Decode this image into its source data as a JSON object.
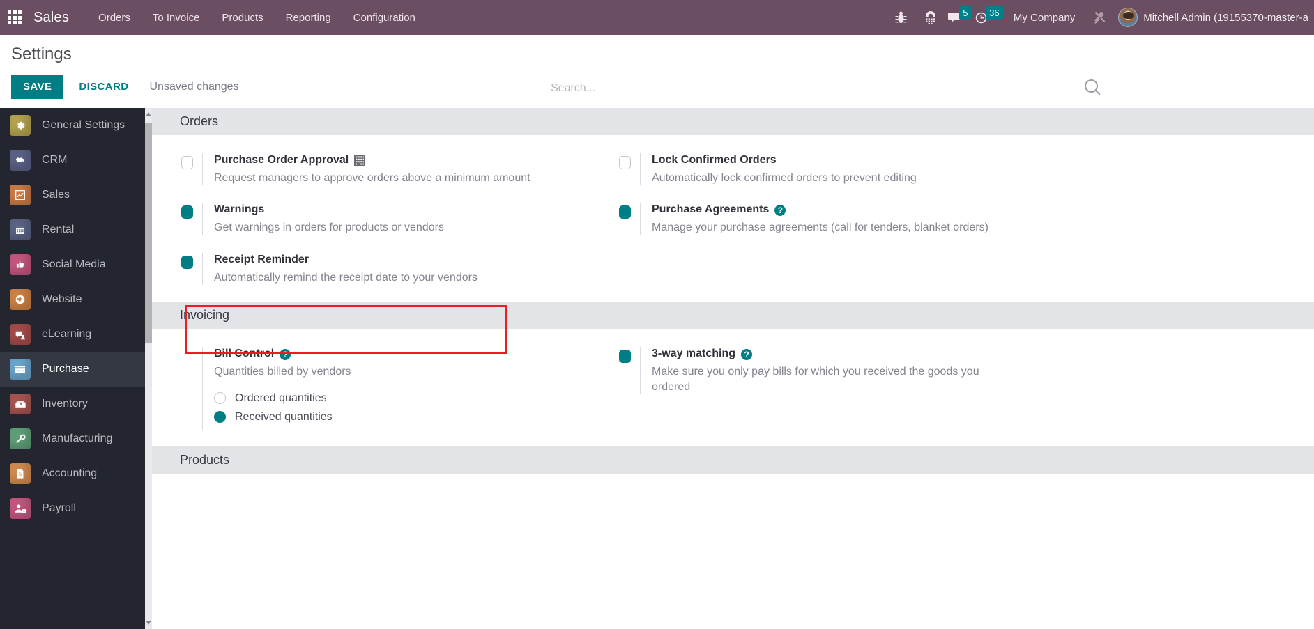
{
  "navbar": {
    "apps_icon": "grid-apps-icon",
    "brand": "Sales",
    "menu": [
      {
        "label": "Orders"
      },
      {
        "label": "To Invoice"
      },
      {
        "label": "Products"
      },
      {
        "label": "Reporting"
      },
      {
        "label": "Configuration"
      }
    ],
    "icons": [
      {
        "name": "bug-icon",
        "glyph": "☣"
      },
      {
        "name": "dialpad-icon",
        "glyph": "☷"
      }
    ],
    "messages": {
      "icon": "chat-bubble-icon",
      "count": "5"
    },
    "activities": {
      "icon": "clock-icon",
      "count": "36"
    },
    "company": "My Company",
    "tools_icon": "tools-icon",
    "user": "Mitchell Admin (19155370-master-a",
    "accent": "#00808a",
    "bar_color": "#6b4e61"
  },
  "control_panel": {
    "title": "Settings",
    "save_label": "SAVE",
    "discard_label": "DISCARD",
    "status": "Unsaved changes",
    "search_placeholder": "Search...",
    "search_value": "",
    "search_icon": "search-icon"
  },
  "sidebar": {
    "items": [
      {
        "label": "General Settings",
        "icon": "gear-icon",
        "glyph": "⚙",
        "color": "#b4a24e",
        "active": false
      },
      {
        "label": "CRM",
        "icon": "handshake-icon",
        "glyph": "✋",
        "color": "#5b6186",
        "active": false
      },
      {
        "label": "Sales",
        "icon": "chart-line-icon",
        "glyph": "↗",
        "color": "#c97a45",
        "active": false
      },
      {
        "label": "Rental",
        "icon": "calendar-icon",
        "glyph": "▦",
        "color": "#5a6285",
        "active": false
      },
      {
        "label": "Social Media",
        "icon": "thumbs-up-icon",
        "glyph": "☝",
        "color": "#c2567e",
        "active": false
      },
      {
        "label": "Website",
        "icon": "globe-icon",
        "glyph": "ἱ0",
        "color": "#cd8145",
        "active": false
      },
      {
        "label": "eLearning",
        "icon": "elearning-icon",
        "glyph": "✎",
        "color": "#a24b49",
        "active": false
      },
      {
        "label": "Purchase",
        "icon": "credit-card-icon",
        "glyph": "▤",
        "color": "#6aa4cc",
        "active": true
      },
      {
        "label": "Inventory",
        "icon": "box-icon",
        "glyph": "▣",
        "color": "#a65450",
        "active": false
      },
      {
        "label": "Manufacturing",
        "icon": "wrench-icon",
        "glyph": "⚒",
        "color": "#5f9e77",
        "active": false
      },
      {
        "label": "Accounting",
        "icon": "dollar-doc-icon",
        "glyph": "$",
        "color": "#d08a4e",
        "active": false
      },
      {
        "label": "Payroll",
        "icon": "payroll-icon",
        "glyph": "☺",
        "color": "#c4567f",
        "active": false
      }
    ]
  },
  "sections": [
    {
      "title": "Orders",
      "left": [
        {
          "name": "purchase-order-approval",
          "title": "Purchase Order Approval",
          "desc": "Request managers to approve orders above a minimum amount",
          "enabled": false,
          "extra_icon": "building-icon"
        },
        {
          "name": "warnings",
          "title": "Warnings",
          "desc": "Get warnings in orders for products or vendors",
          "enabled": true,
          "highlighted": true
        },
        {
          "name": "receipt-reminder",
          "title": "Receipt Reminder",
          "desc": "Automatically remind the receipt date to your vendors",
          "enabled": true
        }
      ],
      "right": [
        {
          "name": "lock-confirmed-orders",
          "title": "Lock Confirmed Orders",
          "desc": "Automatically lock confirmed orders to prevent editing",
          "enabled": false
        },
        {
          "name": "purchase-agreements",
          "title": "Purchase Agreements",
          "desc": "Manage your purchase agreements (call for tenders, blanket orders)",
          "enabled": true,
          "help": "?"
        }
      ]
    },
    {
      "title": "Invoicing",
      "left": [
        {
          "name": "bill-control",
          "title": "Bill Control",
          "desc": "Quantities billed by vendors",
          "enabled": null,
          "help": "?",
          "radios": [
            {
              "label": "Ordered quantities",
              "selected": false
            },
            {
              "label": "Received quantities",
              "selected": true
            }
          ]
        }
      ],
      "right": [
        {
          "name": "three-way-matching",
          "title": "3-way matching",
          "desc": "Make sure you only pay bills for which you received the goods you ordered",
          "enabled": true,
          "help": "?"
        }
      ]
    },
    {
      "title": "Products",
      "left": [],
      "right": []
    }
  ],
  "highlight_color": "#ec1c24"
}
